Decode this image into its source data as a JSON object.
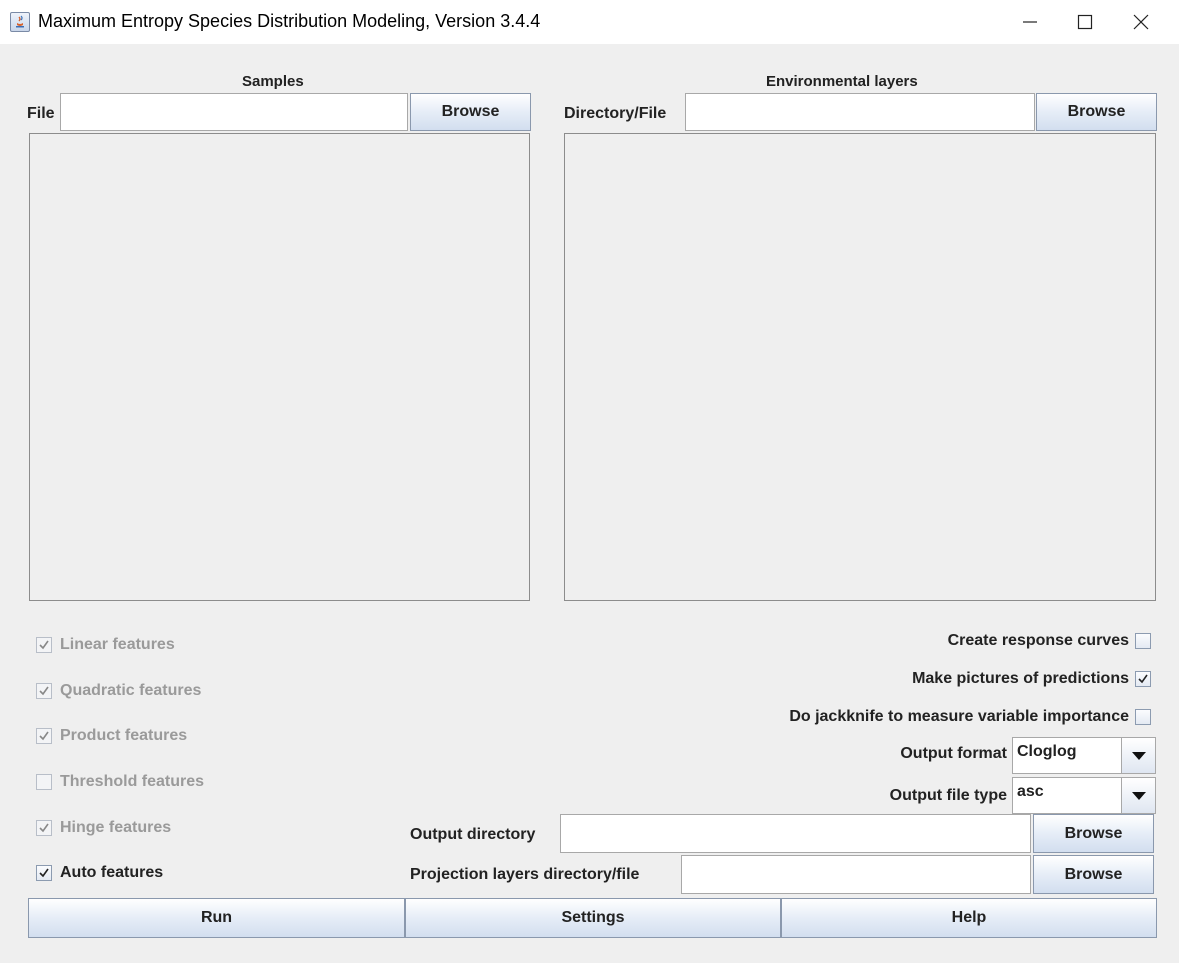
{
  "window": {
    "title": "Maximum Entropy Species Distribution Modeling, Version 3.4.4"
  },
  "samples": {
    "heading": "Samples",
    "file_label": "File",
    "file_value": "",
    "browse_label": "Browse"
  },
  "environment": {
    "heading": "Environmental layers",
    "dir_label": "Directory/File",
    "dir_value": "",
    "browse_label": "Browse"
  },
  "features": [
    {
      "label": "Linear features",
      "checked": true,
      "enabled": false
    },
    {
      "label": "Quadratic features",
      "checked": true,
      "enabled": false
    },
    {
      "label": "Product features",
      "checked": true,
      "enabled": false
    },
    {
      "label": "Threshold features",
      "checked": false,
      "enabled": false
    },
    {
      "label": "Hinge features",
      "checked": true,
      "enabled": false
    },
    {
      "label": "Auto features",
      "checked": true,
      "enabled": true
    }
  ],
  "options": [
    {
      "label": "Create response curves",
      "checked": false
    },
    {
      "label": "Make pictures of predictions",
      "checked": true
    },
    {
      "label": "Do jackknife to measure variable importance",
      "checked": false
    }
  ],
  "output_format": {
    "label": "Output format",
    "value": "Cloglog"
  },
  "output_file_type": {
    "label": "Output file type",
    "value": "asc"
  },
  "output_directory": {
    "label": "Output directory",
    "value": "",
    "browse_label": "Browse"
  },
  "projection": {
    "label": "Projection layers directory/file",
    "value": "",
    "browse_label": "Browse"
  },
  "actions": {
    "run": "Run",
    "settings": "Settings",
    "help": "Help"
  }
}
